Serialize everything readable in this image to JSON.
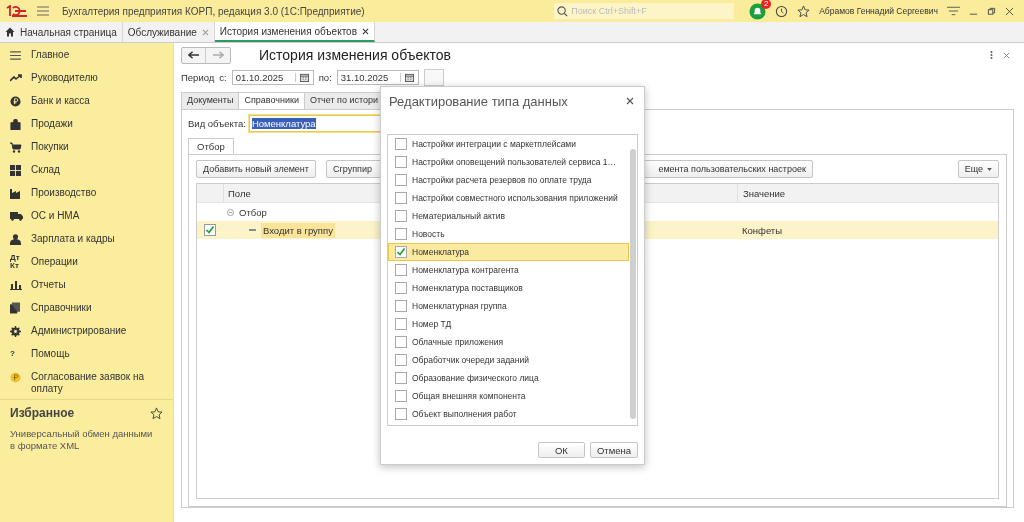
{
  "app": {
    "title": "Бухгалтерия предприятия КОРП, редакция 3.0  (1С:Предприятие)",
    "search_placeholder": "Поиск Ctrl+Shift+F",
    "notifications": "2",
    "user": "Абрамов Геннадий Сергеевич"
  },
  "tabs": [
    {
      "label": "Начальная страница",
      "closable": false,
      "selected": false
    },
    {
      "label": "Обслуживание",
      "closable": true,
      "selected": false
    },
    {
      "label": "История изменения объектов",
      "closable": true,
      "selected": true
    }
  ],
  "sidebar": {
    "items": [
      {
        "label": "Главное"
      },
      {
        "label": "Руководителю"
      },
      {
        "label": "Банк и касса"
      },
      {
        "label": "Продажи"
      },
      {
        "label": "Покупки"
      },
      {
        "label": "Склад"
      },
      {
        "label": "Производство"
      },
      {
        "label": "ОС и НМА"
      },
      {
        "label": "Зарплата и кадры"
      },
      {
        "label": "Операции",
        "icon_text": "Дт Кт"
      },
      {
        "label": "Отчеты"
      },
      {
        "label": "Справочники"
      },
      {
        "label": "Администрирование"
      },
      {
        "label": "Помощь",
        "icon_text": "?"
      },
      {
        "label": "Согласование заявок на оплату"
      }
    ],
    "favorites": {
      "title": "Избранное",
      "items": [
        "Универсальный обмен данными в формате XML"
      ]
    }
  },
  "form": {
    "title": "История изменения объектов",
    "period_label": "Период",
    "from_label": "с:",
    "from": "01.10.2025",
    "to_label": "по:",
    "to": "31.10.2025",
    "tabs": [
      {
        "label": "Документы",
        "selected": false
      },
      {
        "label": "Справочники",
        "selected": true
      },
      {
        "label": "Отчет по истори",
        "selected": false
      }
    ],
    "object_label": "Вид объекта:",
    "object_value": "Номенклатура",
    "subtabs": [
      {
        "label": "Отбор",
        "selected": true
      }
    ],
    "toolbar": [
      "Добавить новый элемент",
      "Сгруппир",
      "емента пользовательских настроек"
    ],
    "more": "Еще",
    "table": {
      "columns": [
        "Поле",
        "Значение"
      ],
      "rows": [
        {
          "kind": "group",
          "field": "Отбор",
          "expanded": true,
          "selected": false
        },
        {
          "kind": "item",
          "checked": true,
          "field": "Входит в группу",
          "value": "Конфеты",
          "selected": true
        }
      ]
    }
  },
  "dialog": {
    "title": "Редактирование типа данных",
    "items": [
      {
        "label": "Настройки интеграции с маркетплейсами",
        "checked": false,
        "selected": false
      },
      {
        "label": "Настройки оповещений пользователей сервиса 1…",
        "checked": false,
        "selected": false
      },
      {
        "label": "Настройки расчета резервов по оплате труда",
        "checked": false,
        "selected": false
      },
      {
        "label": "Настройки совместного использования приложений",
        "checked": false,
        "selected": false
      },
      {
        "label": "Нематериальный актив",
        "checked": false,
        "selected": false
      },
      {
        "label": "Новость",
        "checked": false,
        "selected": false
      },
      {
        "label": "Номенклатура",
        "checked": true,
        "selected": true
      },
      {
        "label": "Номенклатура контрагента",
        "checked": false,
        "selected": false
      },
      {
        "label": "Номенклатура поставщиков",
        "checked": false,
        "selected": false
      },
      {
        "label": "Номенклатурная группа",
        "checked": false,
        "selected": false
      },
      {
        "label": "Номер ТД",
        "checked": false,
        "selected": false
      },
      {
        "label": "Облачные приложения",
        "checked": false,
        "selected": false
      },
      {
        "label": "Обработчик очереди заданий",
        "checked": false,
        "selected": false
      },
      {
        "label": "Образование физического лица",
        "checked": false,
        "selected": false
      },
      {
        "label": "Общая внешняя компонента",
        "checked": false,
        "selected": false
      },
      {
        "label": "Объект выполнения работ",
        "checked": false,
        "selected": false
      }
    ],
    "buttons": [
      "ОК",
      "Отмена"
    ]
  }
}
